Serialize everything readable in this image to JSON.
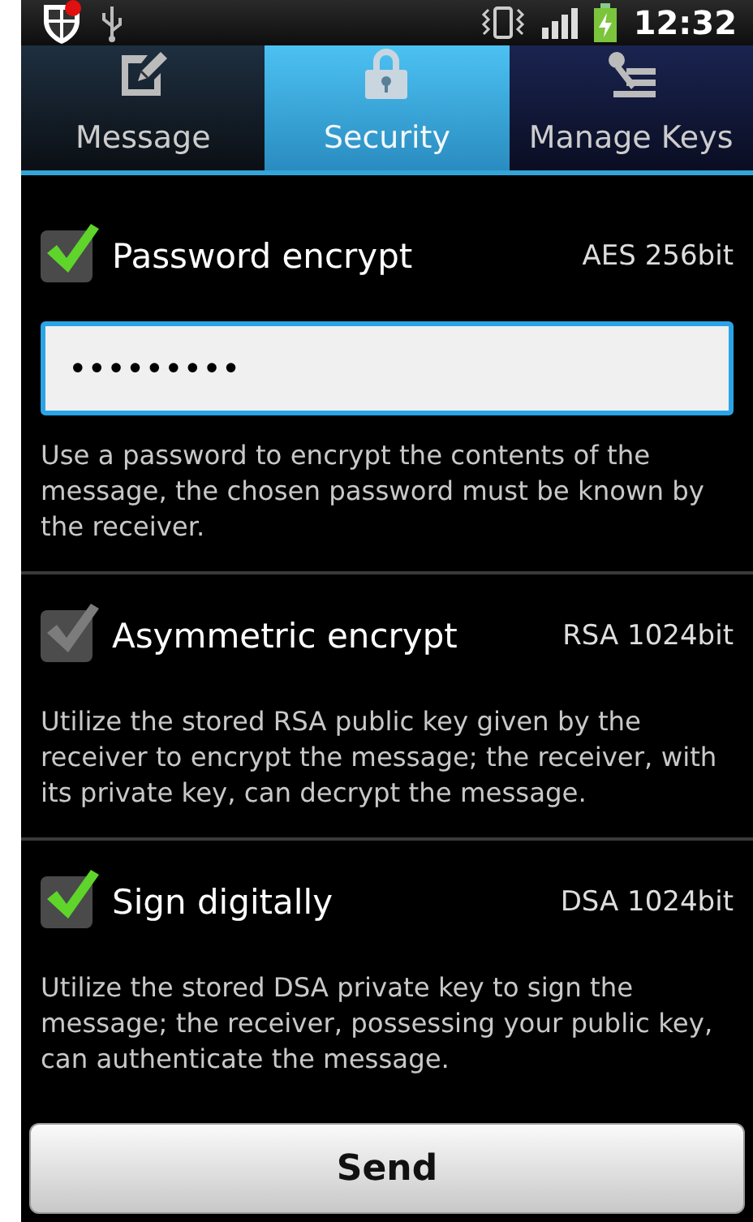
{
  "status_bar": {
    "time": "12:32"
  },
  "tabs": [
    {
      "label": "Message",
      "selected": false
    },
    {
      "label": "Security",
      "selected": true
    },
    {
      "label": "Manage Keys",
      "selected": false
    }
  ],
  "options": [
    {
      "label": "Password encrypt",
      "algorithm": "AES 256bit",
      "checked": true,
      "disabled": false,
      "password": {
        "value": "•••••••••"
      },
      "description": "Use a password to encrypt the contents of the message, the chosen password must be known by the receiver."
    },
    {
      "label": "Asymmetric encrypt",
      "algorithm": "RSA 1024bit",
      "checked": true,
      "disabled": true,
      "description": "Utilize the stored RSA public key given by the receiver to encrypt the message; the receiver, with its private key, can decrypt the message."
    },
    {
      "label": "Sign digitally",
      "algorithm": "DSA 1024bit",
      "checked": true,
      "disabled": false,
      "description": "Utilize the stored DSA private key to sign the message; the receiver, possessing your public key, can authenticate the message."
    }
  ],
  "buttons": [
    "Send"
  ]
}
